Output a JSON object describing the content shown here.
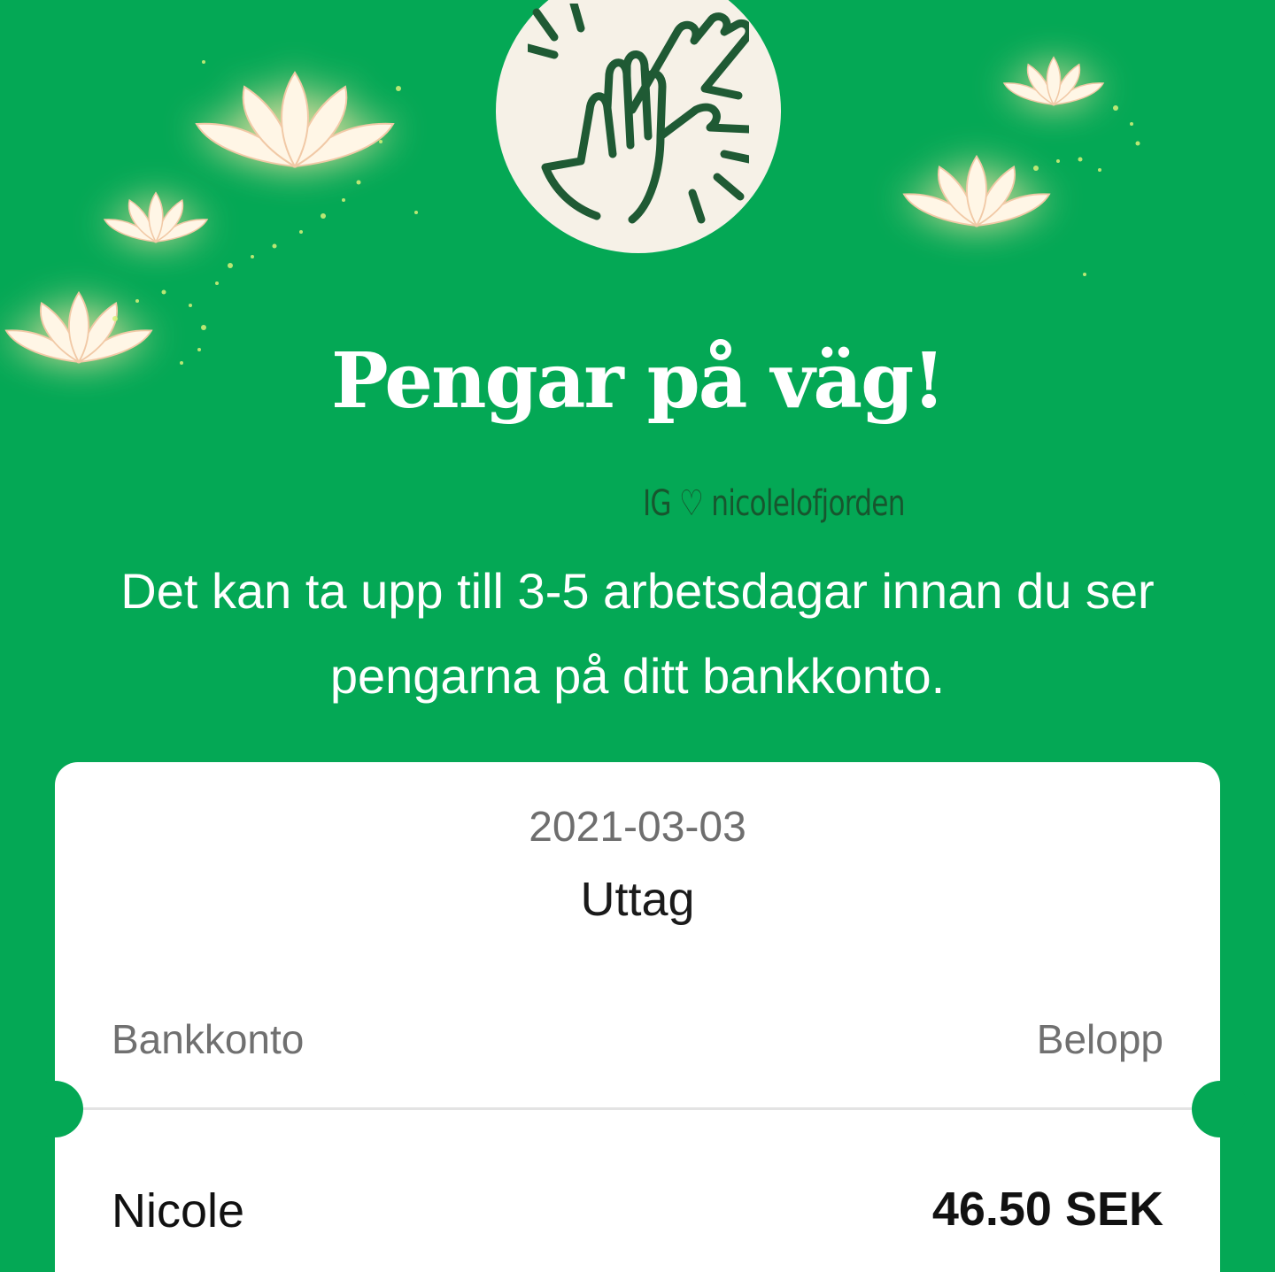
{
  "icons": {
    "badge_icon": "high-five-icon",
    "decoration": "lotus-flower-icon"
  },
  "colors": {
    "background": "#04A855",
    "badge_background": "#F6F1E7",
    "icon_stroke": "#1F5A34",
    "card_background": "#FFFFFF"
  },
  "header": {
    "title": "Pengar på väg!",
    "watermark": "IG ♡ nicolelofjorden",
    "message": "Det kan ta upp till 3-5 arbetsdagar innan du ser pengarna på ditt bankkonto."
  },
  "receipt": {
    "date": "2021-03-03",
    "type": "Uttag",
    "columns": {
      "left": "Bankkonto",
      "right": "Belopp"
    },
    "rows": [
      {
        "account": "Nicole",
        "amount": "46.50 SEK"
      }
    ]
  }
}
